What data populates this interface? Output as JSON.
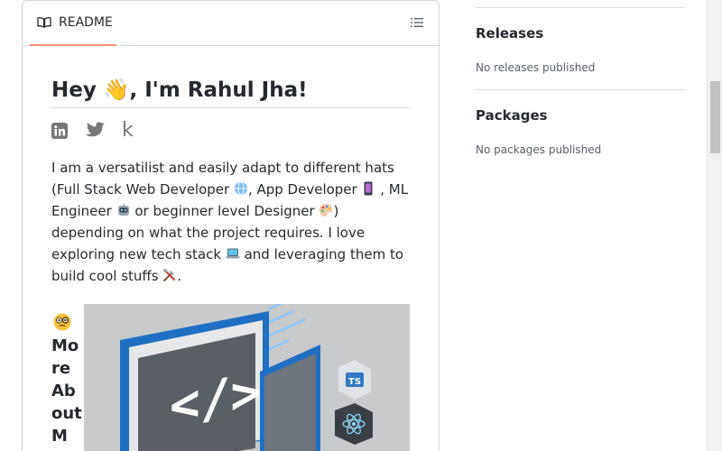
{
  "readme": {
    "tab_label": "README",
    "title": "Hey 👋, I'm Rahul Jha!",
    "social": [
      "linkedin-icon",
      "twitter-icon",
      "kaggle-icon"
    ],
    "kaggle_letter": "k",
    "bio": {
      "p1": "I am a versatilist and easily adapt to different hats (Full Stack Web Developer ",
      "p2": ", App Developer ",
      "p3": " , ML Engineer ",
      "p4": " or beginner level Designer ",
      "p5": ") depending on what the project requires. I love exploring new tech stack ",
      "p6": " and leveraging them to build cool stuffs ",
      "p7": "."
    },
    "more_about": "More About Me:"
  },
  "sidebar": {
    "releases_title": "Releases",
    "releases_text": "No releases published",
    "packages_title": "Packages",
    "packages_text": "No packages published"
  },
  "image_badge": "TS",
  "colors": {
    "tab_underline": "#fd8c73",
    "border": "#d0d7de",
    "muted_text": "#57606a",
    "hero_blue": "#1f6fc4",
    "hero_bg": "#c9cacc"
  }
}
